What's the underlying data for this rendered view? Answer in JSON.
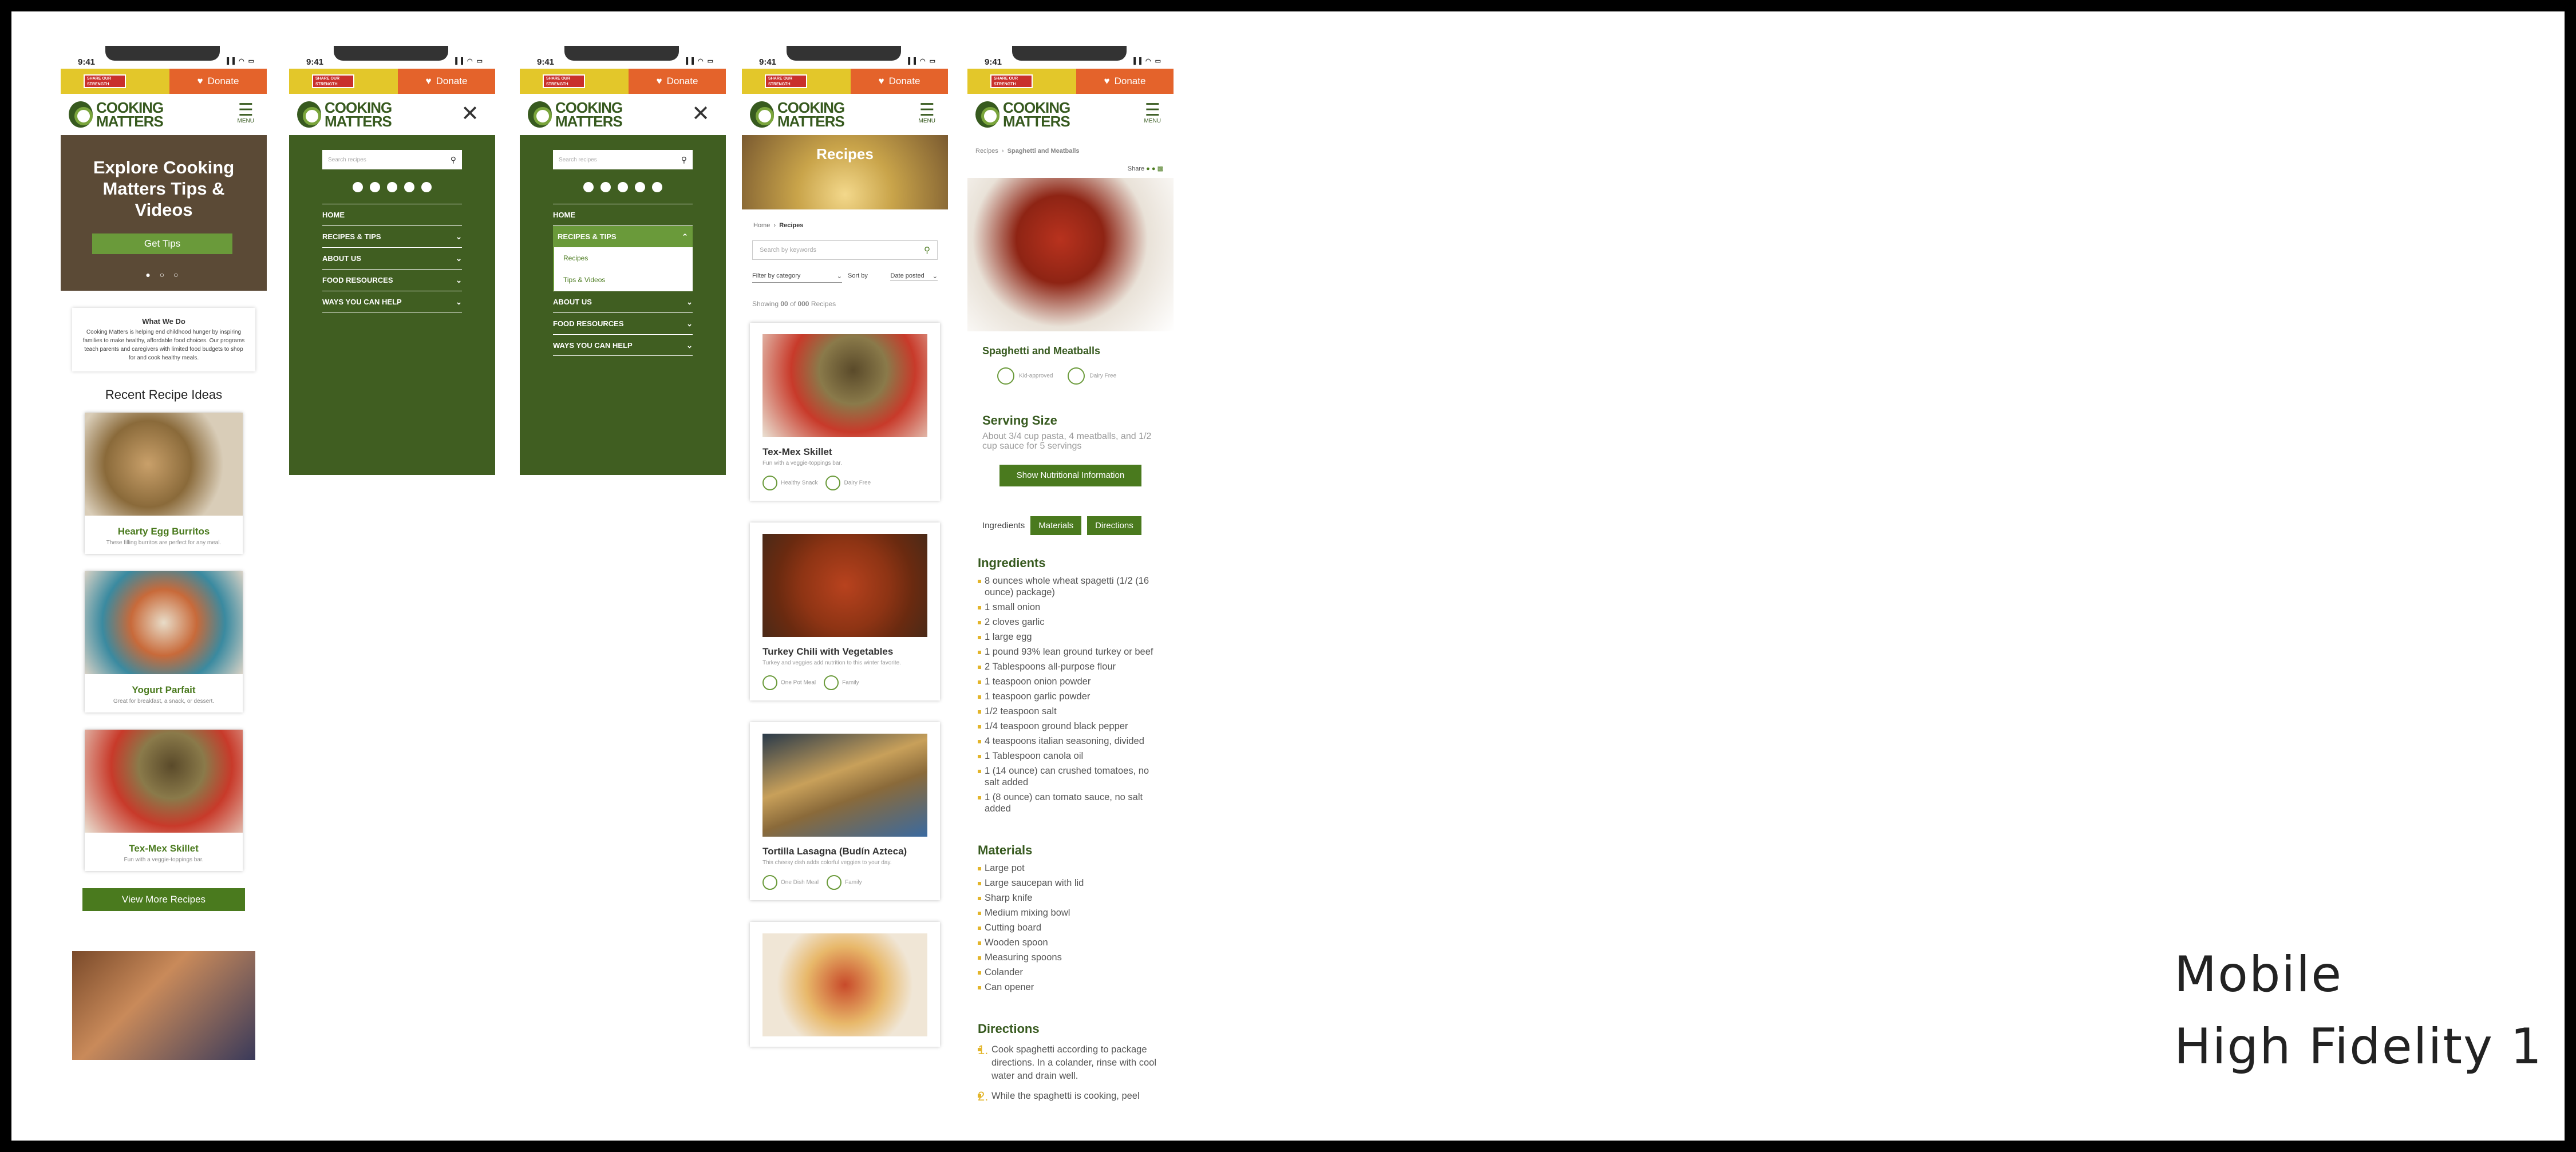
{
  "status": {
    "time": "9:41",
    "signals": "▐▐ ◠ ▭"
  },
  "topbar": {
    "share_badge": "Share Our Strength",
    "donate_label": "Donate",
    "donate_icon": "heart-icon"
  },
  "logo": {
    "line1": "COOKING",
    "line2": "MATTERS"
  },
  "menu": {
    "label": "MENU",
    "icon": "hamburger-icon"
  },
  "home": {
    "hero_title": "Explore Cooking Matters Tips & Videos",
    "hero_button": "Get Tips",
    "carousel_dots": "● ○ ○",
    "what_title": "What We Do",
    "what_text": "Cooking Matters is helping end childhood hunger by inspiring families to make healthy, affordable food choices. Our programs teach parents and caregivers with limited food budgets to shop for and cook healthy meals.",
    "recent_title": "Recent Recipe Ideas",
    "recipes": [
      {
        "title": "Hearty Egg Burritos",
        "desc": "These filling burritos are perfect for any meal."
      },
      {
        "title": "Yogurt Parfait",
        "desc": "Great for breakfast, a snack, or dessert."
      },
      {
        "title": "Tex-Mex Skillet",
        "desc": "Fun with a veggie-toppings bar."
      }
    ],
    "view_more": "View More Recipes"
  },
  "nav": {
    "search_placeholder": "Search recipes",
    "items": [
      {
        "label": "HOME"
      },
      {
        "label": "RECIPES & TIPS"
      },
      {
        "label": "ABOUT US"
      },
      {
        "label": "FOOD RESOURCES"
      },
      {
        "label": "WAYS YOU CAN HELP"
      }
    ],
    "sub_items": [
      "Recipes",
      "Tips & Videos"
    ]
  },
  "list": {
    "hero_title": "Recipes",
    "breadcrumb_home": "Home",
    "breadcrumb_current": "Recipes",
    "search_placeholder": "Search by keywords",
    "filter_label": "Filter by category",
    "sort_label": "Sort by",
    "sort_value": "Date posted",
    "showing_prefix": "Showing",
    "showing_count": "00",
    "showing_of": "of",
    "showing_total": "000",
    "showing_suffix": "Recipes",
    "cards": [
      {
        "title": "Tex-Mex Skillet",
        "desc": "Fun with a veggie-toppings bar.",
        "tag1": "Healthy Snack",
        "tag2": "Dairy Free"
      },
      {
        "title": "Turkey Chili with Vegetables",
        "desc": "Turkey and veggies add nutrition to this winter favorite.",
        "tag1": "One Pot Meal",
        "tag2": "Family"
      },
      {
        "title": "Tortilla Lasagna (Budín Azteca)",
        "desc": "This cheesy dish adds colorful veggies to your day.",
        "tag1": "One Dish Meal",
        "tag2": "Family"
      }
    ]
  },
  "detail": {
    "breadcrumb_parent": "Recipes",
    "breadcrumb_current": "Spaghetti and Meatballs",
    "share_label": "Share",
    "title": "Spaghetti and Meatballs",
    "tag1": "Kid-approved",
    "tag2": "Dairy Free",
    "serving_title": "Serving Size",
    "serving_text": "About 3/4 cup pasta, 4 meatballs, and 1/2 cup sauce for 5 servings",
    "nutrition_button": "Show Nutritional Information",
    "tab_ingredients": "Ingredients",
    "tab_materials": "Materials",
    "tab_directions": "Directions",
    "ingredients_title": "Ingredients",
    "ingredients": [
      "8 ounces whole wheat spagetti (1/2 (16 ounce) package)",
      "1 small onion",
      "2 cloves garlic",
      "1 large egg",
      "1 pound 93% lean ground turkey or beef",
      "2 Tablespoons all-purpose flour",
      "1 teaspoon onion powder",
      "1 teaspoon garlic powder",
      "1/2 teaspoon salt",
      "1/4 teaspoon ground black pepper",
      "4 teaspoons italian seasoning, divided",
      "1 Tablespoon canola oil",
      "1 (14 ounce) can crushed tomatoes, no salt added",
      "1 (8 ounce) can tomato sauce, no salt added"
    ],
    "materials_title": "Materials",
    "materials": [
      "Large pot",
      "Large saucepan with lid",
      "Sharp knife",
      "Medium mixing bowl",
      "Cutting board",
      "Wooden spoon",
      "Measuring spoons",
      "Colander",
      "Can opener"
    ],
    "directions_title": "Directions",
    "directions": [
      {
        "n": "1.",
        "text": "Cook spaghetti according to package directions. In a colander, rinse with cool water and drain well."
      },
      {
        "n": "2.",
        "text": "While the spaghetti is cooking, peel"
      }
    ]
  },
  "board_label": {
    "line1": "Mobile",
    "line2": "High Fidelity 1"
  },
  "colors": {
    "green_dark": "#405e21",
    "green": "#4a7a1e",
    "yellow": "#e3c72a",
    "orange": "#e4632b"
  }
}
